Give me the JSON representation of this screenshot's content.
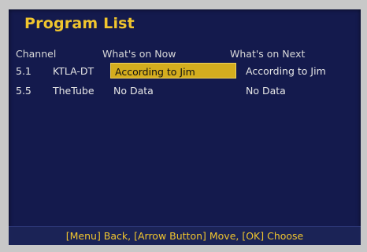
{
  "screen": {
    "title": "Program List"
  },
  "table": {
    "headers": {
      "channel": "Channel",
      "now": "What's on Now",
      "next": "What's on Next"
    },
    "rows": [
      {
        "number": "5.1",
        "name": "KTLA-DT",
        "now": "According to Jim",
        "next": "According to Jim",
        "selected": true
      },
      {
        "number": "5.5",
        "name": "TheTube",
        "now": "No Data",
        "next": "No Data",
        "selected": false
      }
    ]
  },
  "footer": {
    "help_text": "[Menu] Back, [Arrow Button] Move, [OK] Choose"
  },
  "colors": {
    "background": "#141a4d",
    "title": "#f0c52e",
    "selection": "#d4ad1e",
    "text": "#e6e6e6"
  }
}
